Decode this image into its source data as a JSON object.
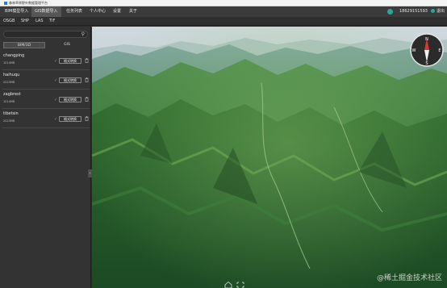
{
  "window": {
    "title": "森林草原野外数据管理平台"
  },
  "menu": {
    "items": [
      {
        "label": "BIM模型导入"
      },
      {
        "label": "GIS数据导入"
      },
      {
        "label": "任务列表"
      },
      {
        "label": "个人中心"
      },
      {
        "label": "设置"
      },
      {
        "label": "关于"
      }
    ],
    "active_index": 1,
    "user_phone": "18629151593",
    "logout_label": "退出"
  },
  "subtoolbar": {
    "items": [
      {
        "label": "OSGB"
      },
      {
        "label": "SHP"
      },
      {
        "label": "LAS"
      },
      {
        "label": "TIF"
      }
    ]
  },
  "sidebar": {
    "search_placeholder": "",
    "tabs": [
      {
        "label": "BIM/3D"
      },
      {
        "label": "GIS"
      }
    ],
    "active_tab": 0,
    "convert_label": "格式转换",
    "files": [
      {
        "name": "changping",
        "size": "1014MB"
      },
      {
        "name": "haihuqu",
        "size": "2023MB"
      },
      {
        "name": "zagbrest",
        "size": "1014MB"
      },
      {
        "name": "tibetsin",
        "size": "2023MB"
      }
    ]
  },
  "viewport": {
    "compass": {
      "n": "N",
      "e": "E",
      "s": "S",
      "w": "W"
    }
  },
  "watermark": "@稀土掘金技术社区",
  "colors": {
    "accent": "#2aa59b",
    "menubar": "#3b3b3b",
    "sidebar": "#333333"
  }
}
